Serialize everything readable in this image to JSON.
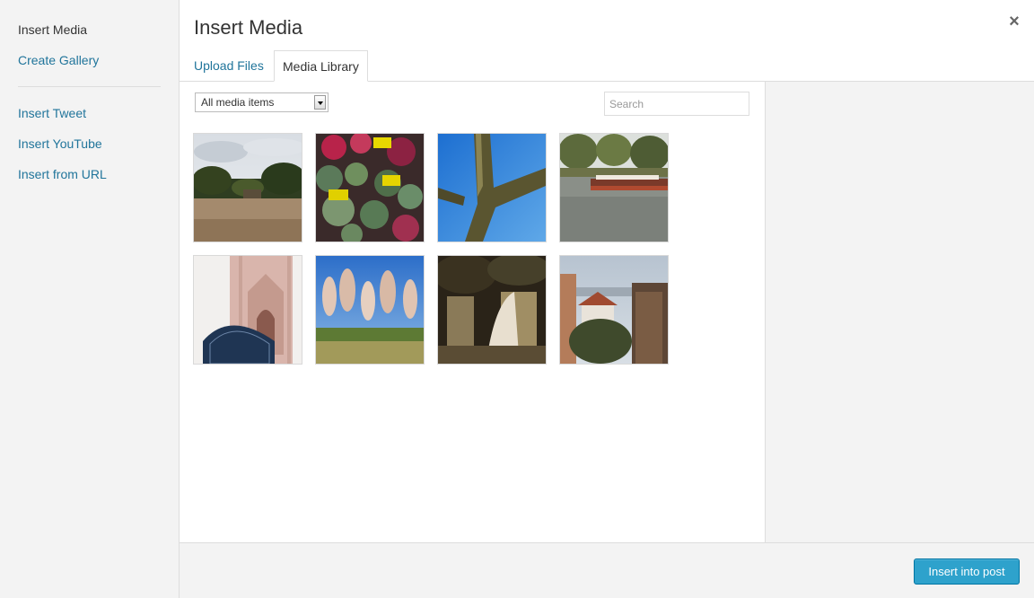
{
  "menu": {
    "items": [
      {
        "label": "Insert Media",
        "active": true
      },
      {
        "label": "Create Gallery",
        "active": false
      },
      {
        "label": "Insert Tweet",
        "active": false
      },
      {
        "label": "Insert YouTube",
        "active": false
      },
      {
        "label": "Insert from URL",
        "active": false
      }
    ]
  },
  "header": {
    "title": "Insert Media",
    "close_icon": "×"
  },
  "tabs": [
    {
      "label": "Upload Files",
      "active": false
    },
    {
      "label": "Media Library",
      "active": true
    }
  ],
  "toolbar": {
    "filter_selected": "All media items",
    "search_placeholder": "Search"
  },
  "footer": {
    "insert_label": "Insert into post"
  },
  "colors": {
    "link": "#21759b",
    "primary_button": "#2ea2cc",
    "sidebar_bg": "#f3f3f3"
  }
}
